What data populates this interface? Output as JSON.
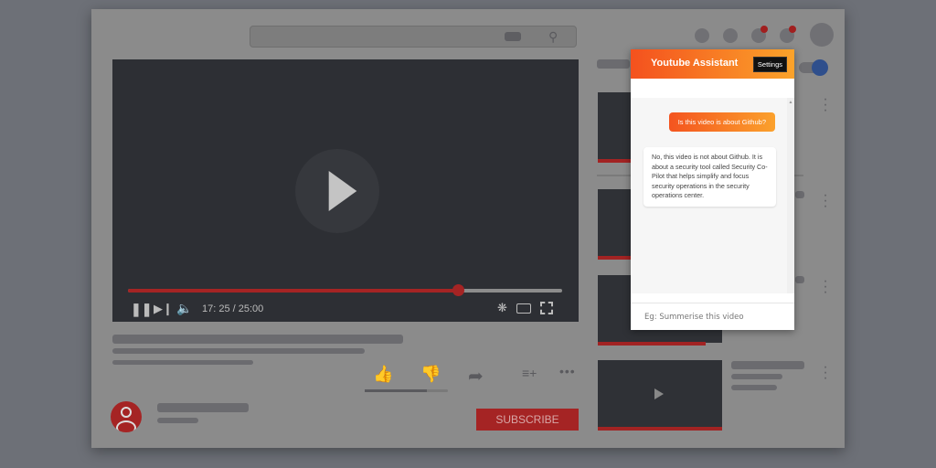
{
  "player": {
    "time": "17: 25 / 25:00",
    "progress": 0.76
  },
  "subscribe_label": "SUBSCRIBE",
  "assistant": {
    "title": "Youtube Assistant",
    "settings_label": "Settings",
    "messages": [
      {
        "role": "user",
        "text": "Is this video is about Github?"
      },
      {
        "role": "assistant",
        "text": "No, this video is not about Github. It is about a security tool called Security Co-Pilot that helps simplify and focus security operations in the security operations center."
      }
    ],
    "input_placeholder": "Eg: Summerise this video"
  },
  "colors": {
    "accent_start": "#f4511e",
    "accent_end": "#fba32a",
    "youtube_red": "#a52424"
  }
}
